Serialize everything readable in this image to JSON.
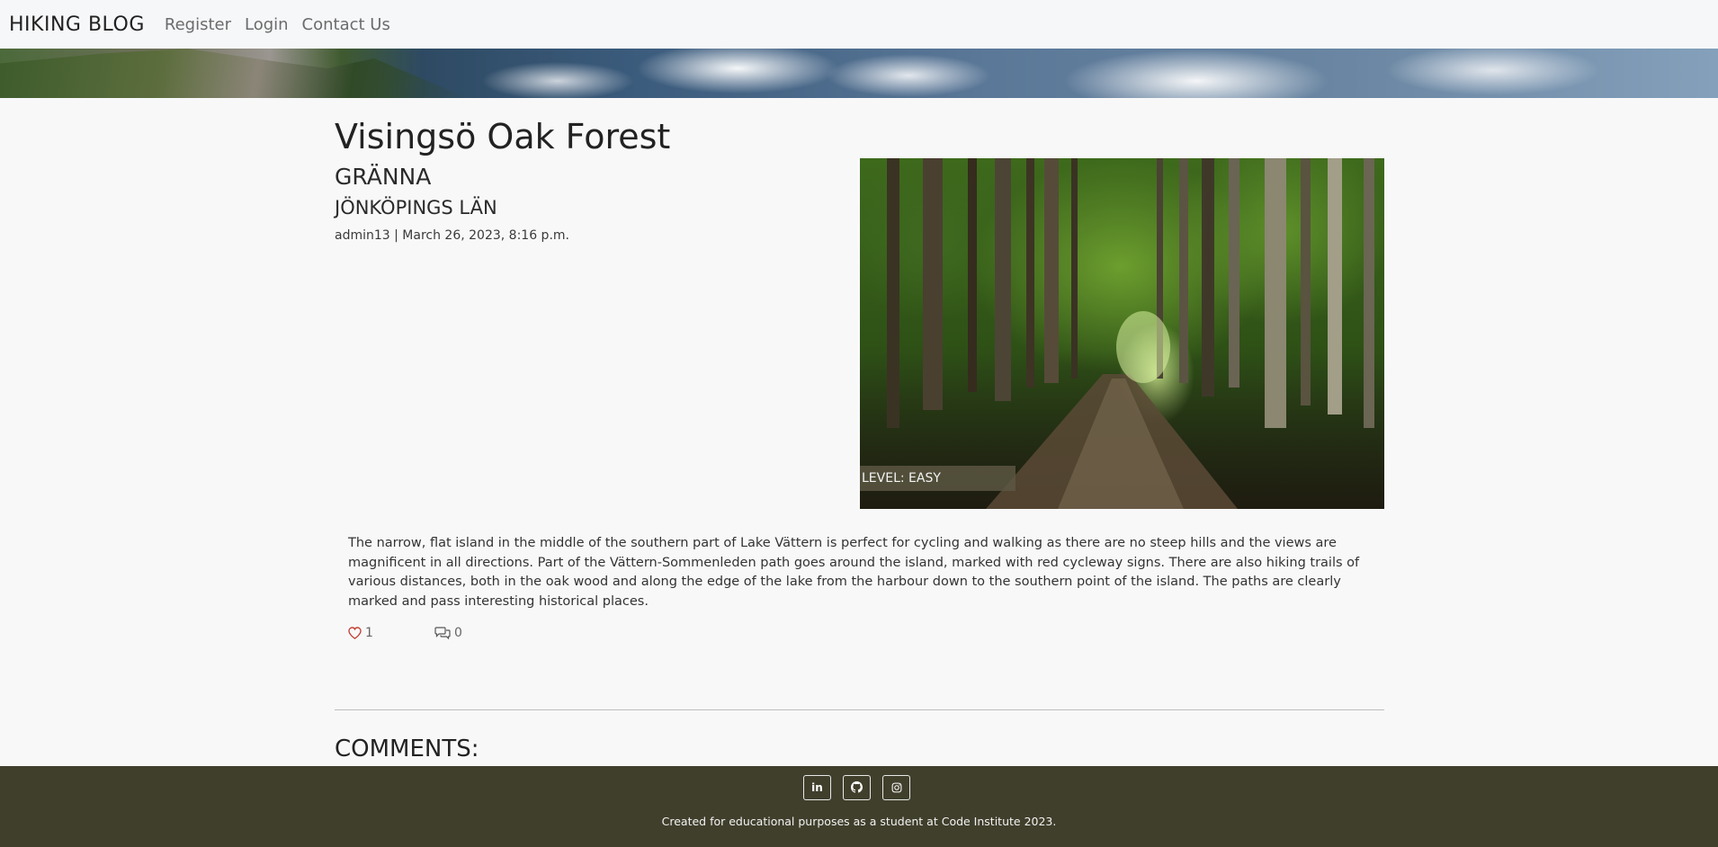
{
  "navbar": {
    "brand": "HIKING BLOG",
    "links": [
      {
        "label": "Register"
      },
      {
        "label": "Login"
      },
      {
        "label": "Contact Us"
      }
    ]
  },
  "post": {
    "title": "Visingsö Oak Forest",
    "town": "GRÄNNA",
    "county": "JÖNKÖPINGS LÄN",
    "meta": "admin13 | March 26, 2023, 8:16 p.m.",
    "level": "LEVEL: EASY",
    "description": "The narrow, flat island in the middle of the southern part of Lake Vättern is perfect for cycling and walking as there are no steep hills and the views are magnificent in all directions. Part of the Vättern-Sommenleden path goes around the island, marked with red cycleway signs. There are also hiking trails of various distances, both in the oak wood and along the edge of the lake from the harbour down to the southern point of the island. The paths are clearly marked and pass interesting historical places.",
    "likes": "1",
    "comment_count": "0",
    "like_icon": "heart-icon",
    "comment_icon": "comments-icon",
    "like_color": "#c0392b"
  },
  "comments": {
    "heading": "COMMENTS:"
  },
  "footer": {
    "social": [
      {
        "icon": "linkedin-icon",
        "glyph": "in"
      },
      {
        "icon": "github-icon"
      },
      {
        "icon": "instagram-icon"
      }
    ],
    "text": "Created for educational purposes as a student at Code Institute 2023.",
    "background": "#403f2c"
  }
}
